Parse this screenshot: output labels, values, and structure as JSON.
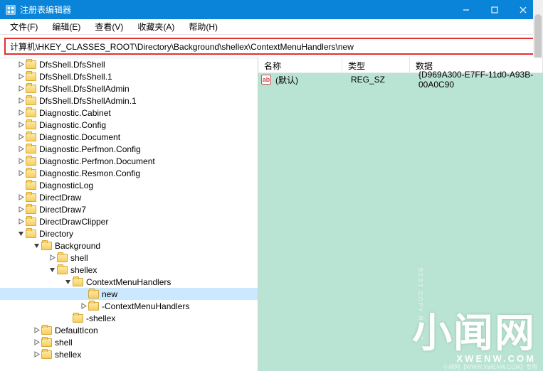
{
  "window": {
    "title": "注册表编辑器"
  },
  "menu": {
    "file": "文件(F)",
    "edit": "编辑(E)",
    "view": "查看(V)",
    "favorites": "收藏夹(A)",
    "help": "帮助(H)"
  },
  "address": {
    "path": "计算机\\HKEY_CLASSES_ROOT\\Directory\\Background\\shellex\\ContextMenuHandlers\\new"
  },
  "columns": {
    "name": "名称",
    "type": "类型",
    "data": "数据"
  },
  "value_row": {
    "icon_text": "ab",
    "name": "(默认)",
    "type": "REG_SZ",
    "data": "{D969A300-E7FF-11d0-A93B-00A0C90"
  },
  "tree": [
    {
      "depth": 0,
      "expander": ">",
      "label": "DfsShell.DfsShell"
    },
    {
      "depth": 0,
      "expander": ">",
      "label": "DfsShell.DfsShell.1"
    },
    {
      "depth": 0,
      "expander": ">",
      "label": "DfsShell.DfsShellAdmin"
    },
    {
      "depth": 0,
      "expander": ">",
      "label": "DfsShell.DfsShellAdmin.1"
    },
    {
      "depth": 0,
      "expander": ">",
      "label": "Diagnostic.Cabinet"
    },
    {
      "depth": 0,
      "expander": ">",
      "label": "Diagnostic.Config"
    },
    {
      "depth": 0,
      "expander": ">",
      "label": "Diagnostic.Document"
    },
    {
      "depth": 0,
      "expander": ">",
      "label": "Diagnostic.Perfmon.Config"
    },
    {
      "depth": 0,
      "expander": ">",
      "label": "Diagnostic.Perfmon.Document"
    },
    {
      "depth": 0,
      "expander": ">",
      "label": "Diagnostic.Resmon.Config"
    },
    {
      "depth": 0,
      "expander": "",
      "label": "DiagnosticLog"
    },
    {
      "depth": 0,
      "expander": ">",
      "label": "DirectDraw"
    },
    {
      "depth": 0,
      "expander": ">",
      "label": "DirectDraw7"
    },
    {
      "depth": 0,
      "expander": ">",
      "label": "DirectDrawClipper"
    },
    {
      "depth": 0,
      "expander": "v",
      "label": "Directory"
    },
    {
      "depth": 1,
      "expander": "v",
      "label": "Background"
    },
    {
      "depth": 2,
      "expander": ">",
      "label": "shell"
    },
    {
      "depth": 2,
      "expander": "v",
      "label": "shellex"
    },
    {
      "depth": 3,
      "expander": "v",
      "label": "ContextMenuHandlers"
    },
    {
      "depth": 4,
      "expander": "",
      "label": "new",
      "selected": true
    },
    {
      "depth": 4,
      "expander": ">",
      "label": "-ContextMenuHandlers"
    },
    {
      "depth": 3,
      "expander": "",
      "label": "-shellex"
    },
    {
      "depth": 1,
      "expander": ">",
      "label": "DefaultIcon"
    },
    {
      "depth": 1,
      "expander": ">",
      "label": "shell"
    },
    {
      "depth": 1,
      "expander": ">",
      "label": "shellex"
    }
  ],
  "watermark": {
    "big": "小闻网",
    "small": "XWENW.COM",
    "side": "BEST COPY RIGHT",
    "footer": "小闻网【WWW.XWENW.COM】专用"
  }
}
